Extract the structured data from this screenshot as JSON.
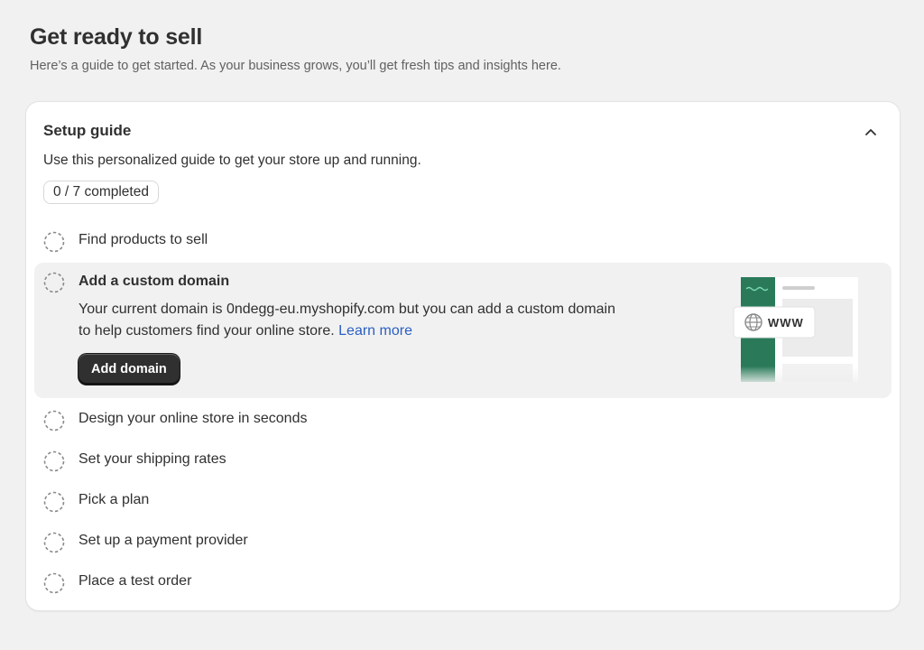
{
  "page": {
    "title": "Get ready to sell",
    "subtitle": "Here’s a guide to get started. As your business grows, you’ll get fresh tips and insights here."
  },
  "setup_guide": {
    "title": "Setup guide",
    "description": "Use this personalized guide to get your store up and running.",
    "progress": "0 / 7 completed",
    "collapse_icon": "chevron-up-icon",
    "steps": [
      {
        "label": "Find products to sell",
        "completed": false
      },
      {
        "label": "Add a custom domain",
        "completed": false,
        "expanded": true,
        "body": "Your current domain is 0ndegg-eu.myshopify.com but you can add a custom domain to help customers find your online store.",
        "link": "Learn more",
        "button": "Add domain",
        "illustration": {
          "badge_text": "WWW",
          "icon": "globe-icon",
          "accent": "#2a7a5a"
        }
      },
      {
        "label": "Design your online store in seconds",
        "completed": false
      },
      {
        "label": "Set your shipping rates",
        "completed": false
      },
      {
        "label": "Pick a plan",
        "completed": false
      },
      {
        "label": "Set up a payment provider",
        "completed": false
      },
      {
        "label": "Place a test order",
        "completed": false
      }
    ]
  },
  "colors": {
    "page_bg": "#f1f1f1",
    "card_bg": "#ffffff",
    "primary_button": "#303030",
    "link": "#2a5fc4"
  }
}
